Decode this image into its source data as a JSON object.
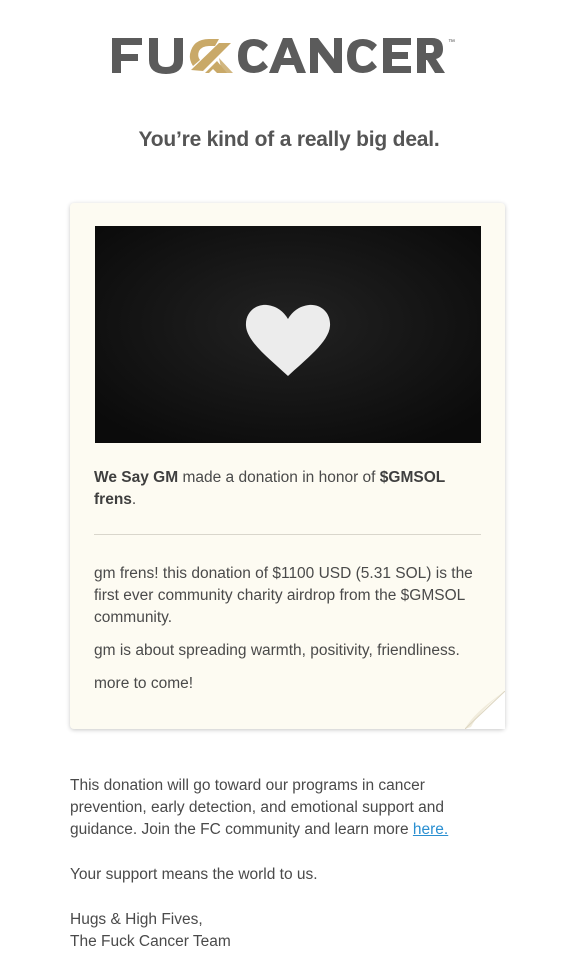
{
  "brand": {
    "logo_text": "FUCKCANCER",
    "trademark": "™",
    "colors": {
      "text": "#5b5b5b",
      "accent": "#c9a968"
    }
  },
  "headline": "You’re kind of a really big deal.",
  "card": {
    "image": {
      "icon": "heart-icon",
      "background": "#111111",
      "heart_color": "#ececec"
    },
    "honor": {
      "donor": "We Say GM",
      "middle": " made a donation in honor of ",
      "honoree": "$GMSOL frens",
      "end": "."
    },
    "message_paragraphs": [
      "gm frens! this donation of $1100 USD (5.31 SOL) is the first ever community charity airdrop from the $GMSOL community.",
      "gm is about spreading warmth, positivity, friendliness.",
      "more to come!"
    ]
  },
  "footer": {
    "programs_text": "This donation will go toward our programs in cancer prevention, early detection, and emotional support and guidance. Join the FC community and learn more ",
    "link_text": "here.",
    "link_color": "#2a8fd1",
    "support_text": "Your support means the world to us.",
    "signoff_line1": "Hugs & High Fives,",
    "signoff_line2": "The Fuck Cancer Team"
  }
}
